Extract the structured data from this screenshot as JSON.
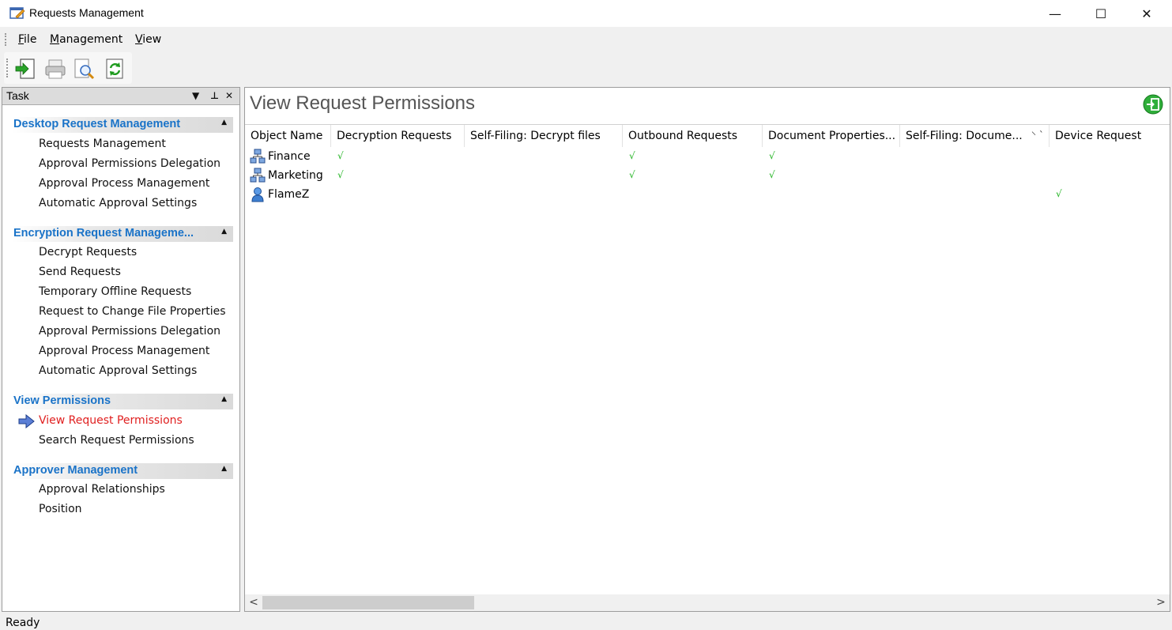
{
  "window": {
    "title": "Requests Management",
    "controls": {
      "minimize": "—",
      "maximize": "☐",
      "close": "✕"
    }
  },
  "menu": {
    "items": [
      {
        "accel": "F",
        "rest": "ile"
      },
      {
        "accel": "M",
        "rest": "anagement"
      },
      {
        "accel": "V",
        "rest": "iew"
      }
    ]
  },
  "toolbar": {
    "buttons": [
      "export-icon",
      "print-icon",
      "print-preview-icon",
      "refresh-icon"
    ]
  },
  "task_pane": {
    "title": "Task",
    "controls": {
      "dropdown": "▼",
      "pin": "ᵖ",
      "close": "✕"
    },
    "groups": [
      {
        "title": "Desktop Request Management",
        "items": [
          "Requests Management",
          "Approval Permissions Delegation",
          "Approval Process Management",
          "Automatic Approval Settings"
        ]
      },
      {
        "title": "Encryption Request Manageme...",
        "items": [
          "Decrypt Requests",
          "Send Requests",
          "Temporary Offline Requests",
          "Request to Change File Properties",
          "Approval Permissions Delegation",
          "Approval Process Management",
          "Automatic Approval Settings"
        ]
      },
      {
        "title": "View Permissions",
        "items": [
          "View Request Permissions",
          "Search Request Permissions"
        ],
        "active_index": 0
      },
      {
        "title": "Approver Management",
        "items": [
          "Approval Relationships",
          "Position"
        ]
      }
    ],
    "collapse_caret": "▲"
  },
  "main": {
    "title": "View Request Permissions",
    "columns": [
      "Object Name",
      "Decryption Requests",
      "Self-Filing: Decrypt files",
      "Outbound Requests",
      "Document Properties...",
      "Self-Filing: Docume...",
      "Device Request"
    ],
    "sort_glyph": "⸌ ˋ",
    "check_mark": "√",
    "rows": [
      {
        "name": "Finance",
        "icon": "group-icon",
        "checks": [
          true,
          false,
          true,
          true,
          false,
          false
        ]
      },
      {
        "name": "Marketing",
        "icon": "group-icon",
        "checks": [
          true,
          false,
          true,
          true,
          false,
          false
        ]
      },
      {
        "name": "FlameZ",
        "icon": "user-icon",
        "checks": [
          false,
          false,
          false,
          false,
          false,
          true
        ]
      }
    ],
    "scroll": {
      "left": "<",
      "right": ">"
    }
  },
  "status": {
    "text": "Ready"
  },
  "colors": {
    "accent": "#1a73c8",
    "active": "#e02020",
    "check": "#22b422"
  }
}
